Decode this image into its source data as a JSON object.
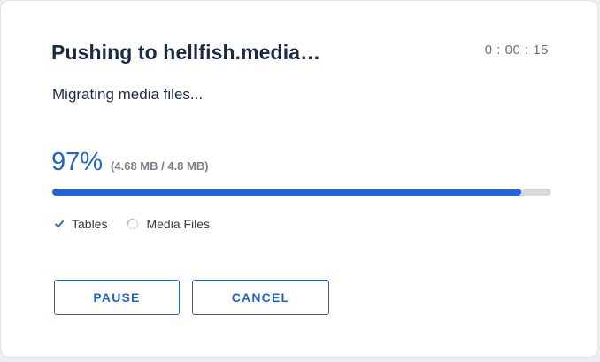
{
  "dialog": {
    "title": "Pushing to hellfish.media…",
    "timer": "0 : 00 : 15",
    "stage": "Migrating media files..."
  },
  "progress": {
    "percent_label": "97%",
    "size_label": "(4.68 MB / 4.8 MB)",
    "fraction": 0.94,
    "color": "#2563d9"
  },
  "steps": [
    {
      "label": "Tables",
      "status": "done",
      "icon": "check-icon"
    },
    {
      "label": "Media Files",
      "status": "in-progress",
      "icon": "spinner-icon"
    }
  ],
  "actions": {
    "pause_label": "PAUSE",
    "cancel_label": "CANCEL"
  },
  "colors": {
    "accent": "#2563c9",
    "title": "#1d2a44",
    "muted": "#7a7f87"
  }
}
